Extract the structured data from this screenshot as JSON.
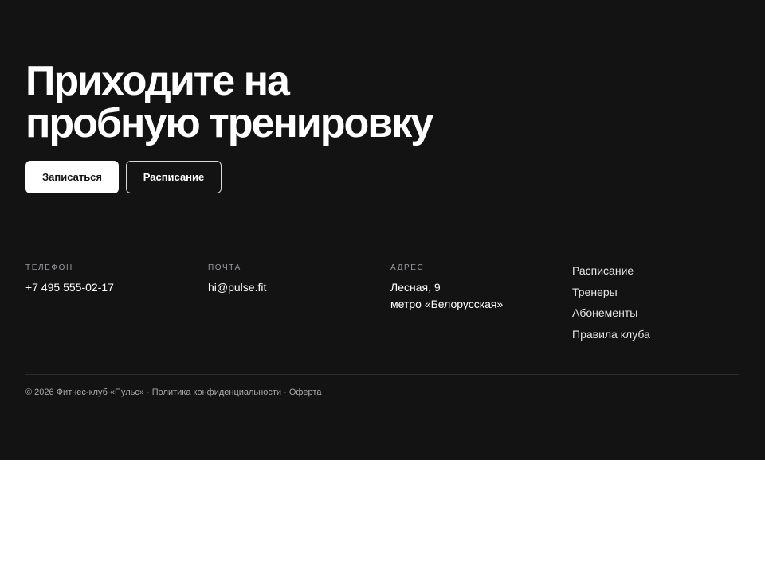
{
  "cta": {
    "heading_line1": "Приходите на",
    "heading_line2": "пробную тренировку",
    "primary_button": "Записаться",
    "secondary_button": "Расписание"
  },
  "contacts": {
    "phone_label": "ТЕЛЕФОН",
    "phone_value": "+7 495 555-02-17",
    "email_label": "ПОЧТА",
    "email_value": "hi@pulse.fit",
    "address_label": "АДРЕС",
    "address_line1": "Лесная, 9",
    "address_line2": "метро «Белорусская»"
  },
  "nav": {
    "items": [
      "Расписание",
      "Тренеры",
      "Абонементы",
      "Правила клуба"
    ]
  },
  "legal": {
    "copyright": "© 2026 Фитнес-клуб «Пульс»",
    "separator": " · ",
    "privacy": "Политика конфиденциальности",
    "offer": "Оферта"
  },
  "colors": {
    "footer_background": "#131314",
    "primary_button_background": "#ffffff",
    "text_primary": "#ffffff",
    "text_muted": "#9b9b9f"
  }
}
